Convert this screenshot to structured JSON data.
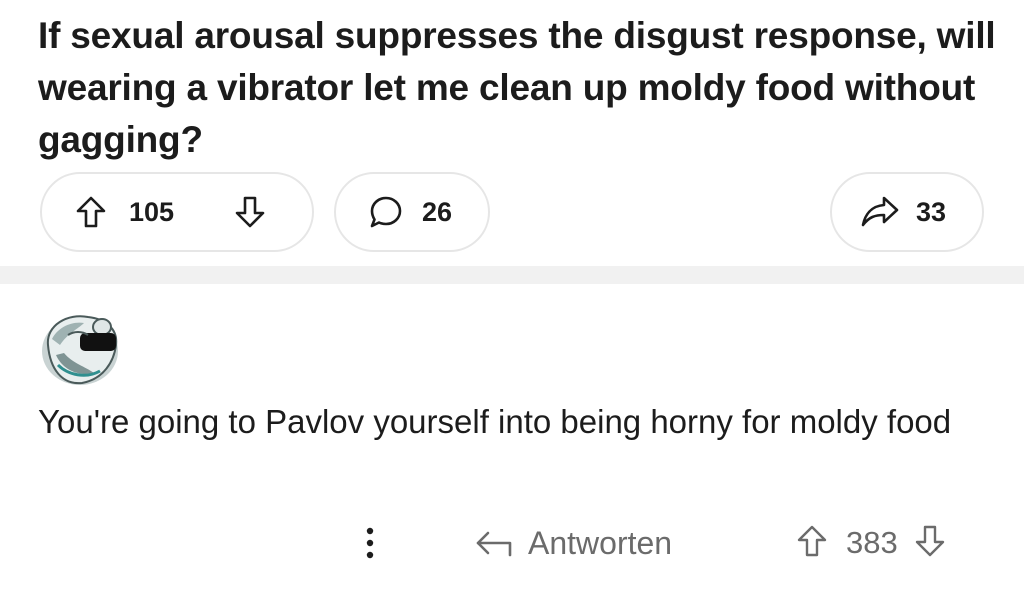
{
  "post": {
    "title": "If sexual arousal suppresses the disgust response, will wearing a vibrator let me clean up moldy food without gagging?",
    "upvote_count": "105",
    "comment_count": "26",
    "share_count": "33"
  },
  "comment": {
    "avatar_icon": "bear-avatar-icon",
    "text": "You're going to Pavlov yourself into being horny for moldy food",
    "reply_label": "Antworten",
    "vote_count": "383"
  },
  "colors": {
    "text_primary": "#1c1c1c",
    "text_secondary": "#6b6b6b",
    "pill_border": "#e6e6e6",
    "divider": "#f1f1f1"
  }
}
